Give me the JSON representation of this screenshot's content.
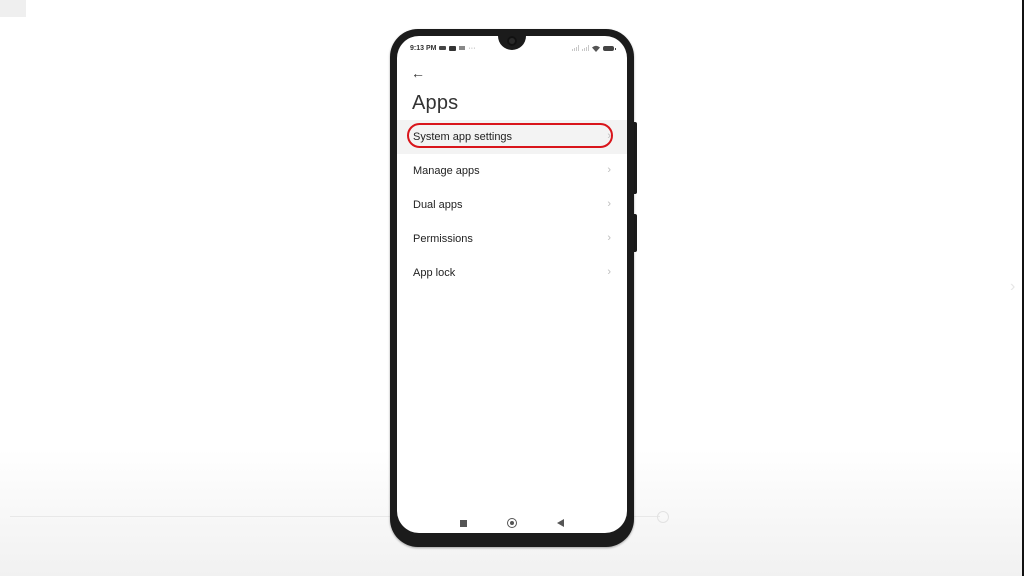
{
  "status_bar": {
    "time": "9:13 PM",
    "notification_icons": [
      "video-camera-icon",
      "youtube-icon",
      "mail-icon"
    ],
    "more_indicator": "···",
    "right_icons": [
      "signal-icon",
      "signal-icon",
      "wifi-icon",
      "battery-icon"
    ]
  },
  "header": {
    "back_icon": "←",
    "title": "Apps"
  },
  "menu": {
    "items": [
      {
        "label": "System app settings",
        "chevron": "›",
        "highlighted": true
      },
      {
        "label": "Manage apps",
        "chevron": "›"
      },
      {
        "label": "Dual apps",
        "chevron": "›"
      },
      {
        "label": "Permissions",
        "chevron": "›"
      },
      {
        "label": "App lock",
        "chevron": "›"
      }
    ]
  },
  "nav_bar": {
    "buttons": [
      "recent-apps",
      "home",
      "back"
    ]
  },
  "colors": {
    "highlight_ring": "#d9151b",
    "phone_frame": "#1b1b1b"
  },
  "background": {
    "edge_chevron": "›"
  }
}
